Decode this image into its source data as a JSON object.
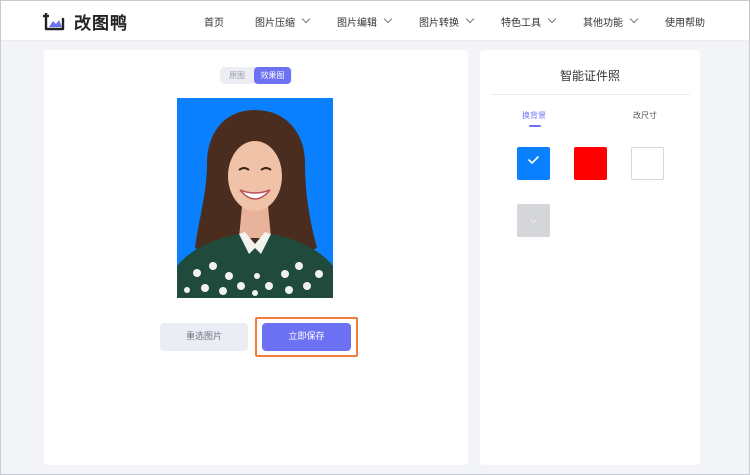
{
  "app": {
    "logo_text": "改图鸭"
  },
  "nav": {
    "items": [
      {
        "label": "首页",
        "has_dropdown": false
      },
      {
        "label": "图片压缩",
        "has_dropdown": true
      },
      {
        "label": "图片编辑",
        "has_dropdown": true
      },
      {
        "label": "图片转换",
        "has_dropdown": true
      },
      {
        "label": "特色工具",
        "has_dropdown": true
      },
      {
        "label": "其他功能",
        "has_dropdown": true
      },
      {
        "label": "使用帮助",
        "has_dropdown": false
      }
    ]
  },
  "preview": {
    "toggle": {
      "original_label": "原图",
      "result_label": "效果图",
      "active": "result"
    },
    "reselect_label": "重选图片",
    "save_label": "立即保存"
  },
  "settings": {
    "title": "智能证件照",
    "tabs": [
      {
        "label": "换背景",
        "active": true
      },
      {
        "label": "改尺寸",
        "active": false
      }
    ],
    "colors": [
      {
        "name": "blue",
        "hex": "#0a80ff",
        "selected": true
      },
      {
        "name": "red",
        "hex": "#ff0000",
        "selected": false
      },
      {
        "name": "white",
        "hex": "#ffffff",
        "selected": false
      },
      {
        "name": "gray",
        "hex": "#d5d6da",
        "selected": false
      }
    ]
  },
  "colors": {
    "accent": "#6d72f4",
    "highlight": "#f07c3e",
    "photo_background": "#0a80ff"
  }
}
